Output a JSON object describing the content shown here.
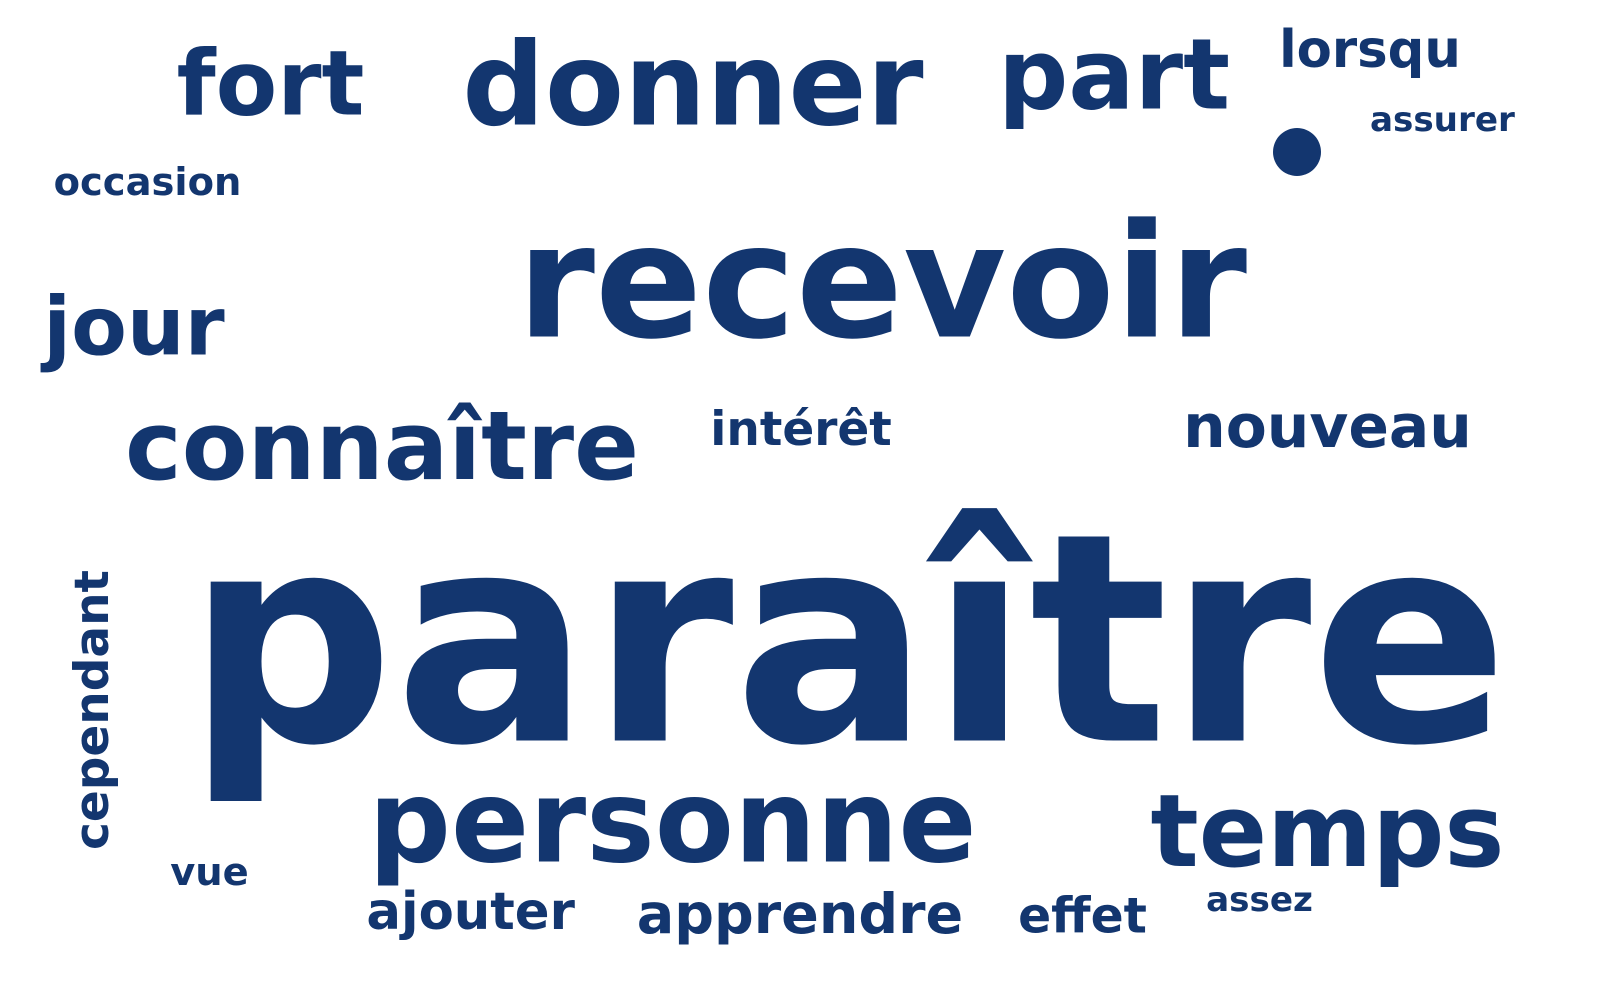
{
  "word_cloud": {
    "color": "#13366F",
    "words": [
      {
        "text": "paraître",
        "rotated": false
      },
      {
        "text": "recevoir",
        "rotated": false
      },
      {
        "text": "personne",
        "rotated": false
      },
      {
        "text": "donner",
        "rotated": false
      },
      {
        "text": "connaître",
        "rotated": false
      },
      {
        "text": "nouveau",
        "rotated": false
      },
      {
        "text": "temps",
        "rotated": false
      },
      {
        "text": "part",
        "rotated": false
      },
      {
        "text": "fort",
        "rotated": false
      },
      {
        "text": "jour",
        "rotated": false
      },
      {
        "text": "cependant",
        "rotated": true
      },
      {
        "text": "apprendre",
        "rotated": false
      },
      {
        "text": "ajouter",
        "rotated": false
      },
      {
        "text": "effet",
        "rotated": false
      },
      {
        "text": "vue",
        "rotated": false
      },
      {
        "text": "occasion",
        "rotated": false
      },
      {
        "text": "lorsqu",
        "rotated": false
      },
      {
        "text": "assurer",
        "rotated": false
      },
      {
        "text": "intérêt",
        "rotated": false
      },
      {
        "text": "assez",
        "rotated": false
      }
    ]
  }
}
